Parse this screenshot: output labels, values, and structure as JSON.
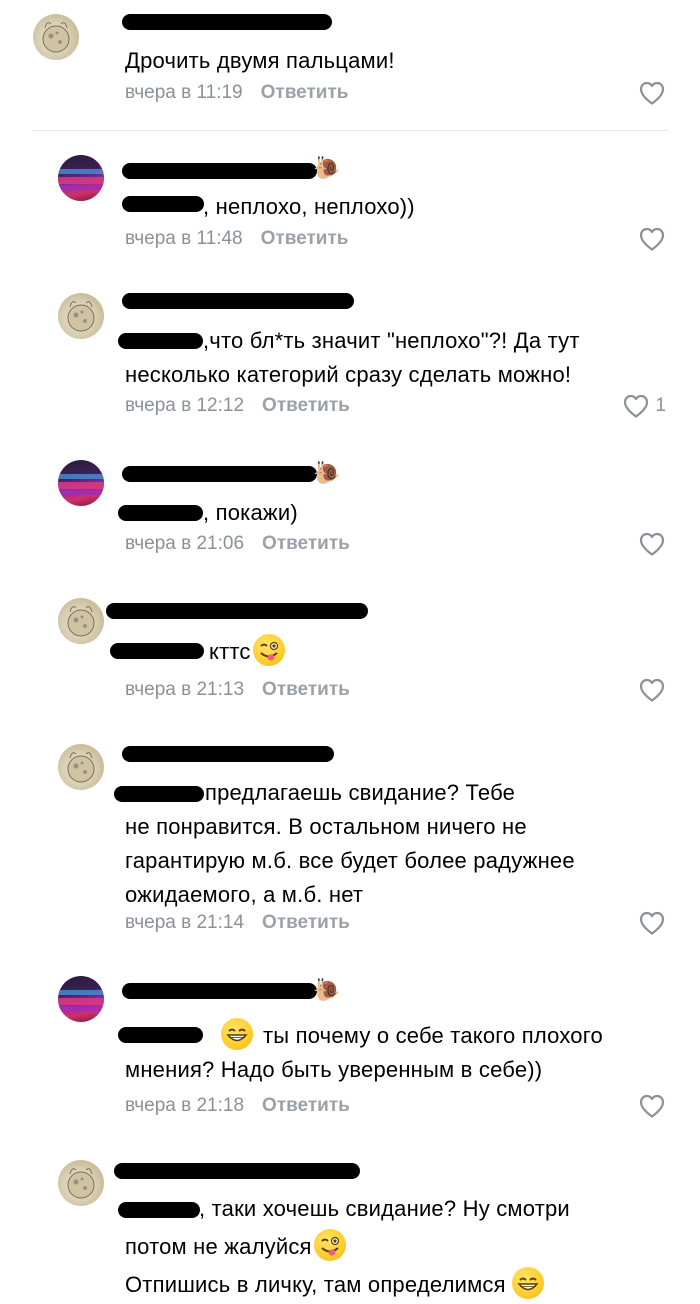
{
  "comments": [
    {
      "text": "Дрочить двумя пальцами!",
      "time": "вчера в 11:19",
      "reply": "Ответить",
      "likes": ""
    },
    {
      "text": ", неплохо, неплохо))",
      "time": "вчера в 11:48",
      "reply": "Ответить",
      "likes": ""
    },
    {
      "text_line1": ",что бл*ть значит \"неплохо\"?! Да тут",
      "text_line2": "несколько категорий сразу сделать можно!",
      "time": "вчера в 12:12",
      "reply": "Ответить",
      "likes": "1"
    },
    {
      "text": ", покажи)",
      "time": "вчера в 21:06",
      "reply": "Ответить",
      "likes": ""
    },
    {
      "text": "кттс",
      "time": "вчера в 21:13",
      "reply": "Ответить",
      "likes": ""
    },
    {
      "text_line1": "предлагаешь свидание? Тебе",
      "text_line2": "не понравится. В остальном ничего не",
      "text_line3": "гарантирую м.б. все будет более радужнее",
      "text_line4": "ожидаемого, а м.б. нет",
      "time": "вчера в 21:14",
      "reply": "Ответить",
      "likes": ""
    },
    {
      "text_line1": "ты почему о себе такого плохого",
      "text_line2": "мнения? Надо быть уверенным в себе))",
      "time": "вчера в 21:18",
      "reply": "Ответить",
      "likes": ""
    },
    {
      "text_line1": ", таки хочешь свидание? Ну смотри",
      "text_line2": "потом не жалуйся",
      "text_line3": "Отпишись в личку, там определимся",
      "time": "",
      "reply": "",
      "likes": ""
    }
  ],
  "icons": {
    "like": "heart-outline-icon",
    "snail": "snail-emoji",
    "wink": "winking-tongue-emoji",
    "grin": "grinning-emoji"
  },
  "colors": {
    "meta": "#8a9199",
    "divider": "#e3e5e8"
  }
}
